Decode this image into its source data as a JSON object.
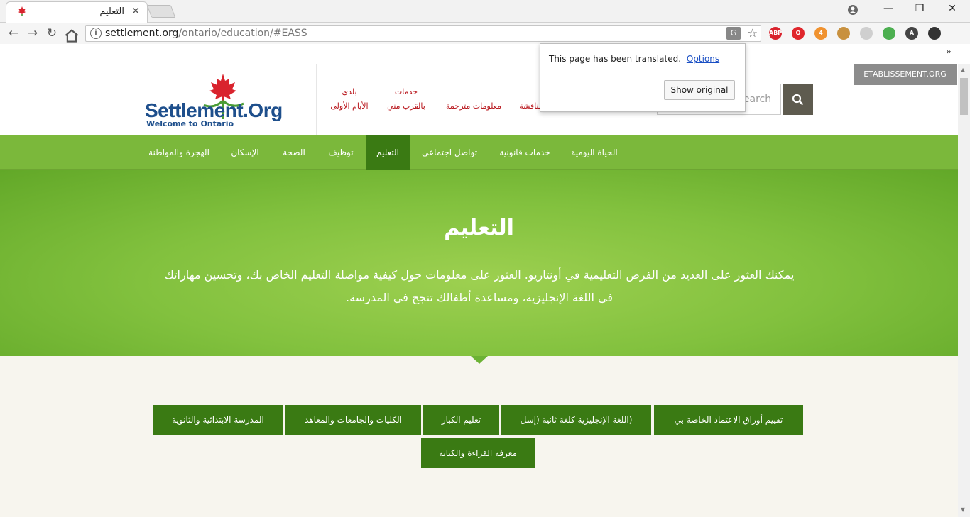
{
  "browser": {
    "tab_title": "التعليم",
    "tab_close": "✕",
    "url_host": "settlement.org",
    "url_path": "/ontario/education/#EASS",
    "window_min": "—",
    "window_max": "❐",
    "window_close": "✕",
    "overflow": "»",
    "extensions": [
      {
        "name": "adblock",
        "label": "ABP",
        "color": "#d9232d"
      },
      {
        "name": "opera",
        "label": "O",
        "color": "#e0262c"
      },
      {
        "name": "todo",
        "label": "4",
        "color": "#f0922f"
      },
      {
        "name": "cookie",
        "label": "",
        "color": "#c8913f"
      },
      {
        "name": "pdf",
        "label": "",
        "color": "#cfcfcf"
      },
      {
        "name": "green",
        "label": "",
        "color": "#4caf50"
      },
      {
        "name": "a-ext",
        "label": "A",
        "color": "#444444"
      },
      {
        "name": "dark",
        "label": "",
        "color": "#333333"
      }
    ]
  },
  "translate_popup": {
    "message": "This page has been translated.",
    "options_link": "Options",
    "show_original": "Show original"
  },
  "header": {
    "logo_name": "Settlement.Org",
    "logo_tagline": "Welcome to Ontario",
    "links": [
      {
        "line1": "بلدي",
        "line2": "الأيام الأولى"
      },
      {
        "line1": "خدمات",
        "line2": "بالقرب مني"
      },
      {
        "line1": "",
        "line2": "معلومات مترجمة"
      },
      {
        "line1": "",
        "line2": "مناقشة"
      }
    ],
    "etab": "ETABLISSEMENT.ORG",
    "search_placeholder": "Search"
  },
  "nav": {
    "items": [
      "الحياة اليومية",
      "خدمات قانونية",
      "تواصل اجتماعي",
      "التعليم",
      "توظيف",
      "الصحة",
      "الإسكان",
      "الهجرة والمواطنة"
    ],
    "active": "التعليم"
  },
  "hero": {
    "title": "التعليم",
    "description": "يمكنك العثور على العديد من الفرص التعليمية في أونتاريو. العثور على معلومات حول كيفية مواصلة التعليم الخاص بك، وتحسين مهاراتك في اللغة الإنجليزية، ومساعدة أطفالك تنجح في المدرسة."
  },
  "topics": [
    "تقييم أوراق الاعتماد الخاصة بي",
    "(اللغة الإنجليزية كلغة ثانية (إسل",
    "تعليم الكبار",
    "الكليات والجامعات والمعاهد",
    "المدرسة الابتدائية والثانوية",
    "معرفة القراءة والكتابة"
  ],
  "colors": {
    "nav_green": "#7bb83b",
    "active_green": "#3a7a13",
    "brand_red": "#b8151b",
    "brand_blue": "#1e4f8c"
  }
}
